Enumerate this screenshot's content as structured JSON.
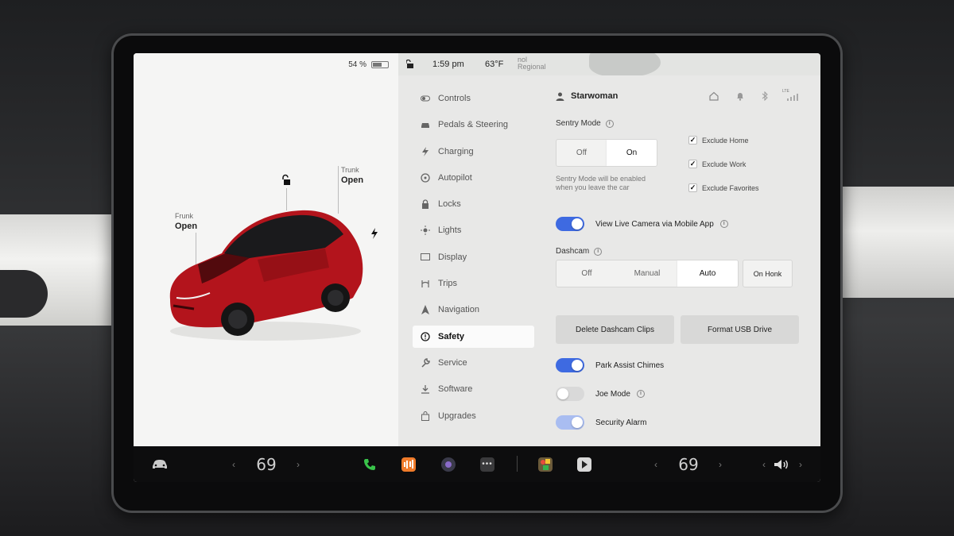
{
  "status": {
    "battery_percent": "54 %",
    "battery_level": 0.54,
    "time": "1:59 pm",
    "temperature": "63°F",
    "map_label": "nol Regional"
  },
  "car": {
    "frunk_label": "Frunk",
    "frunk_state": "Open",
    "trunk_label": "Trunk",
    "trunk_state": "Open",
    "body_color": "#b3141c"
  },
  "menu": {
    "items": [
      {
        "label": "Controls",
        "icon": "toggle-icon"
      },
      {
        "label": "Pedals & Steering",
        "icon": "car-icon"
      },
      {
        "label": "Charging",
        "icon": "bolt-icon"
      },
      {
        "label": "Autopilot",
        "icon": "steering-wheel-icon"
      },
      {
        "label": "Locks",
        "icon": "lock-icon"
      },
      {
        "label": "Lights",
        "icon": "sun-icon"
      },
      {
        "label": "Display",
        "icon": "display-icon"
      },
      {
        "label": "Trips",
        "icon": "trips-icon"
      },
      {
        "label": "Navigation",
        "icon": "navigation-icon"
      },
      {
        "label": "Safety",
        "icon": "safety-icon"
      },
      {
        "label": "Service",
        "icon": "wrench-icon"
      },
      {
        "label": "Software",
        "icon": "download-icon"
      },
      {
        "label": "Upgrades",
        "icon": "bag-icon"
      }
    ],
    "active_index": 9
  },
  "profile": {
    "name": "Starwoman",
    "lte_label": "LTE"
  },
  "sentry": {
    "title": "Sentry Mode",
    "off_label": "Off",
    "on_label": "On",
    "hint_line1": "Sentry Mode will be enabled",
    "hint_line2": "when you leave the car",
    "exclude_home": "Exclude Home",
    "exclude_work": "Exclude Work",
    "exclude_favorites": "Exclude Favorites"
  },
  "live_camera": {
    "label": "View Live Camera via Mobile App"
  },
  "dashcam": {
    "title": "Dashcam",
    "off_label": "Off",
    "manual_label": "Manual",
    "auto_label": "Auto",
    "on_honk_label": "On Honk"
  },
  "buttons": {
    "delete_clips": "Delete Dashcam Clips",
    "format_usb": "Format USB Drive"
  },
  "toggles": {
    "park_assist": "Park Assist Chimes",
    "joe_mode": "Joe Mode",
    "security_alarm": "Security Alarm"
  },
  "bottom": {
    "driver_temp": "69",
    "passenger_temp": "69",
    "accent_green": "#39c34a",
    "accent_orange": "#f07b2a"
  }
}
